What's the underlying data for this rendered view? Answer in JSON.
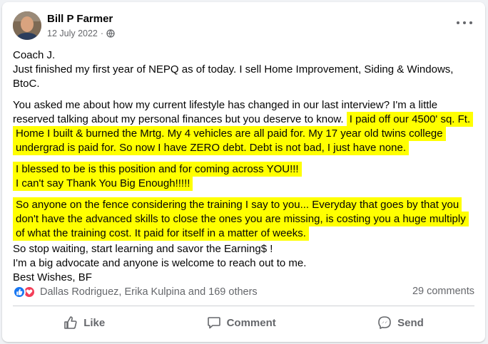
{
  "post": {
    "author": "Bill P Farmer",
    "date": "12 July 2022",
    "privacy_icon": "globe-icon",
    "options_icon": "more-options-icon",
    "paragraphs": [
      {
        "lines": [
          "Coach J.",
          "Just finished my first year of NEPQ as of today.  I sell Home Improvement, Siding & Windows, BtoC."
        ]
      }
    ],
    "p2_plain": "You asked me about how my current lifestyle has changed in our last interview?  I'm a little reserved talking about my personal finances but you deserve to know.",
    "p2_highlight": "I paid off our 4500' sq. Ft. Home I built & burned the Mrtg.  My 4 vehicles are all paid for.  My 17 year old twins college undergrad is paid for.  So now I have ZERO debt.  Debt is not bad, I just have none.",
    "p3_line1": "I blessed to be is this position and for coming across YOU!!!",
    "p3_line2": "I can't say Thank You Big Enough!!!!!",
    "p4_highlight": "So anyone on the fence considering the training I say to you... Everyday that goes by that you don't have the advanced skills to close the ones you are missing, is costing you a huge multiply of what the training cost. It paid for itself in a matter of weeks.",
    "closing_lines": [
      "So stop waiting, start learning and savor the Earning$ !",
      "I'm a big advocate and anyone is welcome to reach out to me.",
      "Best Wishes, BF"
    ]
  },
  "reactions": {
    "icons": [
      "like-reaction-icon",
      "love-reaction-icon"
    ],
    "summary": "Dallas Rodriguez, Erika Kulpina and 169 others",
    "comments": "29 comments"
  },
  "actions": {
    "like": "Like",
    "comment": "Comment",
    "send": "Send"
  },
  "colors": {
    "highlight": "#ffff00",
    "like_blue": "#1877f2",
    "love_red": "#f33e58",
    "secondary_text": "#65676b"
  }
}
